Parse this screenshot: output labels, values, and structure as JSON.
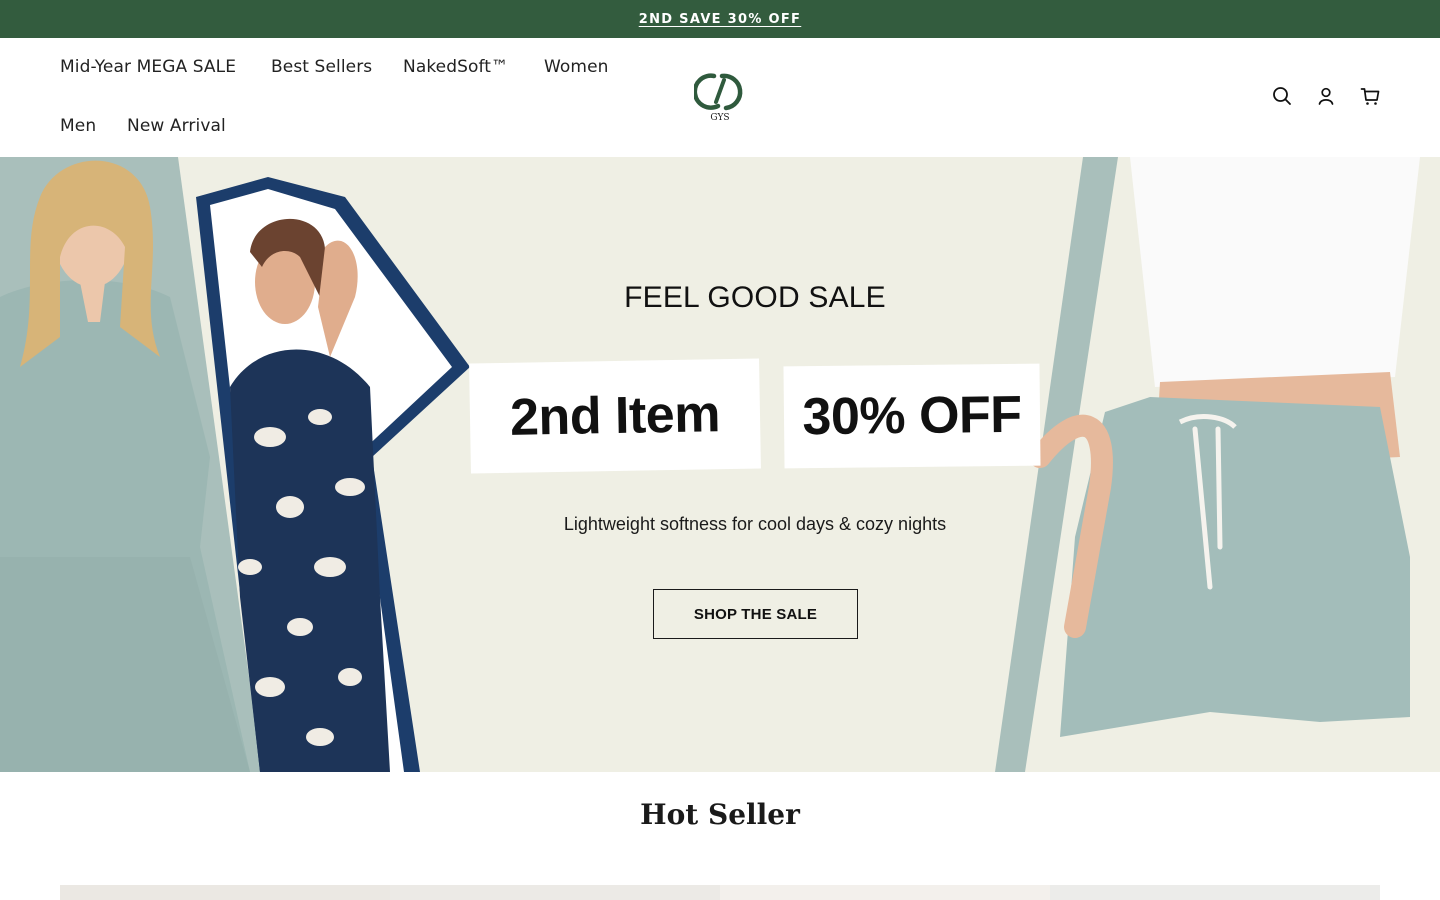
{
  "announcement": {
    "text": "2ND SAVE 30% OFF",
    "bg": "#335c3e"
  },
  "nav": {
    "items": [
      {
        "label": "Mid-Year MEGA SALE"
      },
      {
        "label": "Best Sellers"
      },
      {
        "label": "NakedSoft™"
      },
      {
        "label": "Women"
      },
      {
        "label": "Men"
      },
      {
        "label": "New Arrival"
      }
    ]
  },
  "logo": {
    "text": "GYS"
  },
  "header_icons": [
    "search-icon",
    "account-icon",
    "cart-icon"
  ],
  "hero": {
    "headline": "FEEL GOOD SALE",
    "tag_1": "2nd Item",
    "tag_2": "30% OFF",
    "subtitle": "Lightweight softness for cool days & cozy nights",
    "cta": "SHOP THE SALE",
    "bg": "#efefe4",
    "accent_sage": "#a9bfbb",
    "accent_navy": "#1c3d6b"
  },
  "hot_seller": {
    "title": "Hot Seller"
  }
}
